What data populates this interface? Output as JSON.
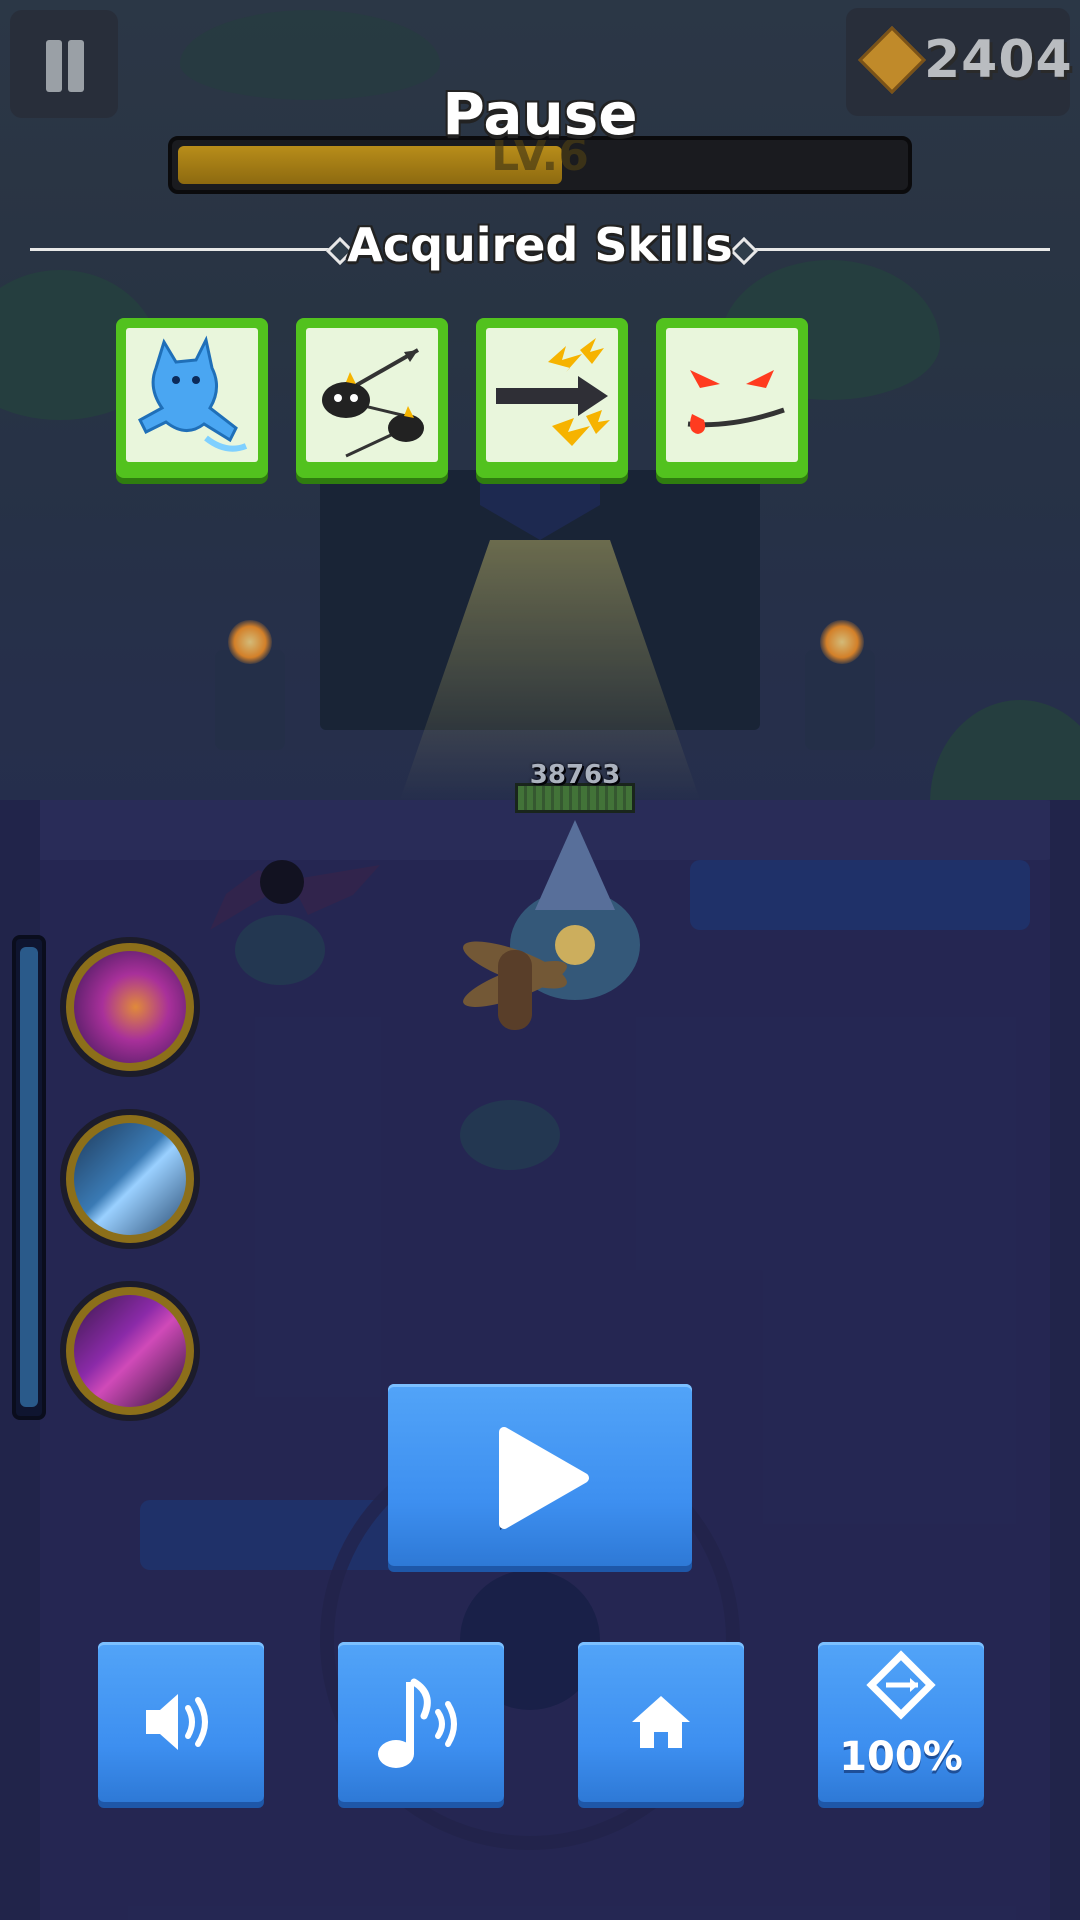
{
  "hud": {
    "currency": {
      "icon": "arrow-diamond-icon",
      "value": "2404"
    },
    "level_label": "LV.6",
    "level_progress": 0.53
  },
  "pause_menu": {
    "title": "Pause",
    "skills_heading": "Acquired Skills",
    "skills": [
      {
        "icon": "blue-cat-icon"
      },
      {
        "icon": "bouncing-arrow-icon"
      },
      {
        "icon": "piercing-arrow-lightning-icon"
      },
      {
        "icon": "evil-grin-icon"
      }
    ],
    "resume_icon": "play-icon",
    "buttons": [
      {
        "icon": "speaker-icon"
      },
      {
        "icon": "music-note-icon"
      },
      {
        "icon": "home-icon"
      },
      {
        "icon": "arrow-diamond-icon",
        "label": "100%"
      }
    ]
  },
  "game": {
    "boss_hp": "38763",
    "abilities": [
      {
        "icon": "purple-orb-icon"
      },
      {
        "icon": "ice-blade-icon"
      },
      {
        "icon": "shadow-strike-icon"
      }
    ]
  }
}
